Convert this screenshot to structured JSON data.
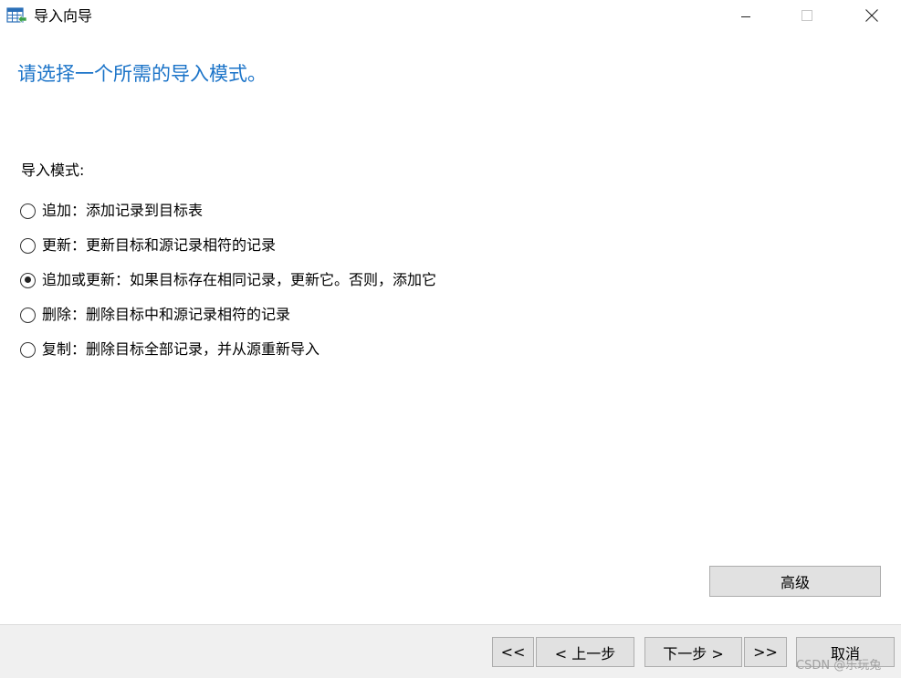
{
  "window": {
    "title": "导入向导",
    "icon": "table-import-icon",
    "controls": {
      "minimize_icon": "minimize-icon",
      "maximize_icon": "maximize-icon",
      "close_icon": "close-icon"
    }
  },
  "heading": "请选择一个所需的导入模式。",
  "mode_group": {
    "label": "导入模式:",
    "selected_index": 2,
    "options": [
      {
        "label": "追加：添加记录到目标表",
        "checked": false
      },
      {
        "label": "更新：更新目标和源记录相符的记录",
        "checked": false
      },
      {
        "label": "追加或更新：如果目标存在相同记录，更新它。否则，添加它",
        "checked": true
      },
      {
        "label": "删除：删除目标中和源记录相符的记录",
        "checked": false
      },
      {
        "label": "复制：删除目标全部记录，并从源重新导入",
        "checked": false
      }
    ]
  },
  "buttons": {
    "advanced": "高级",
    "first": "<<",
    "prev": "< 上一步",
    "next": "下一步 >",
    "last": ">>",
    "cancel": "取消"
  },
  "watermark": "CSDN @乐玩兔",
  "colors": {
    "heading": "#1a73c8",
    "button_bg": "#e1e1e1",
    "footer_bg": "#f0f0f0"
  }
}
